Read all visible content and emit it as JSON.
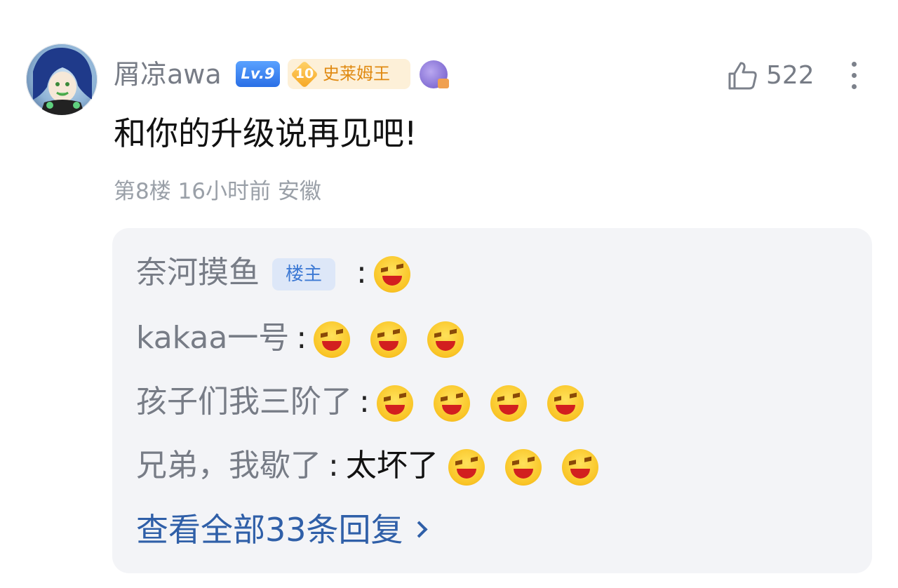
{
  "comment": {
    "username": "屑凉awa",
    "level_badge": "Lv.9",
    "fan_badge": {
      "level": "10",
      "name": "史莱姆王"
    },
    "like_count": "522",
    "text": "和你的升级说再见吧!",
    "meta": "第8楼 16小时前 安徽"
  },
  "replies": [
    {
      "author": "奈河摸鱼",
      "badge": "楼主",
      "text": "",
      "emoji_count": 1
    },
    {
      "author": "kakaa一号",
      "text": "",
      "emoji_count": 3
    },
    {
      "author": "孩子们我三阶了",
      "text": "",
      "emoji_count": 4
    },
    {
      "author": "兄弟，我歇了",
      "text": "太坏了",
      "emoji_count": 3
    }
  ],
  "colon": ":",
  "view_all": "查看全部33条回复",
  "icons": {
    "like": "thumbs-up-icon",
    "more": "more-vertical-icon",
    "emoji": "laughing-emoji-icon"
  },
  "colors": {
    "link": "#2f5fa8",
    "reply_bg": "#f3f4f7",
    "level_badge": "#2a6fe6",
    "fan_badge_text": "#e08a12"
  }
}
